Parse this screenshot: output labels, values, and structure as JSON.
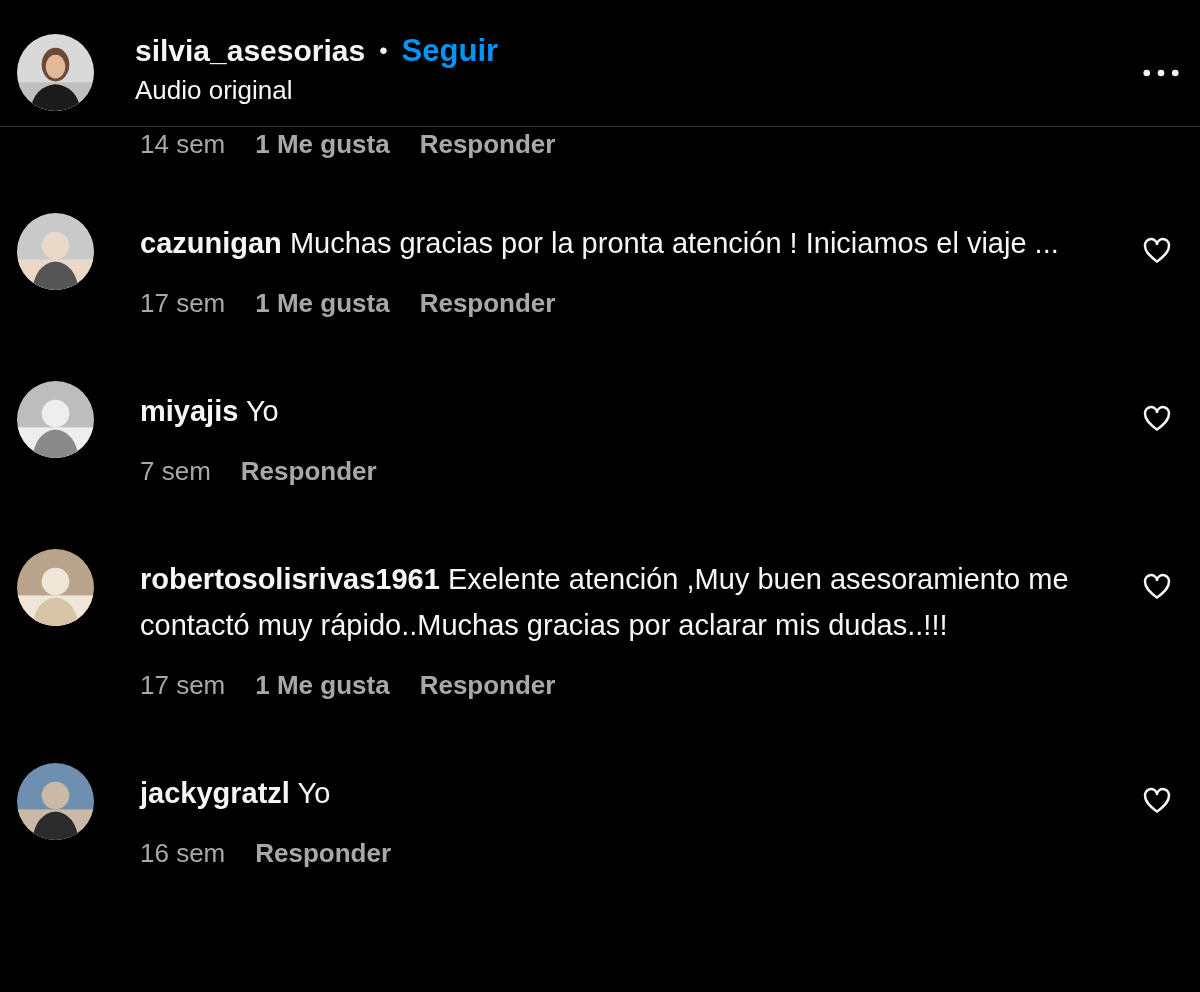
{
  "header": {
    "username": "silvia_asesorias",
    "separator": "•",
    "follow": "Seguir",
    "audio": "Audio original"
  },
  "partial_meta": {
    "time": "14 sem",
    "likes": "1 Me gusta",
    "reply": "Responder"
  },
  "comments": [
    {
      "username": "cazunigan",
      "text": "Muchas gracias por la pronta atención ! Iniciamos el viaje ...",
      "time": "17 sem",
      "likes": "1 Me gusta",
      "reply": "Responder"
    },
    {
      "username": "miyajis",
      "text": "Yo",
      "time": "7 sem",
      "reply": "Responder"
    },
    {
      "username": "robertosolisrivas1961",
      "text": "Exelente atención ,Muy buen asesoramiento me contactó muy rápido..Muchas gracias por aclarar mis dudas..!!!",
      "time": "17 sem",
      "likes": "1 Me gusta",
      "reply": "Responder"
    },
    {
      "username": "jackygratzl",
      "text": "Yo",
      "time": "16 sem",
      "reply": "Responder"
    }
  ]
}
